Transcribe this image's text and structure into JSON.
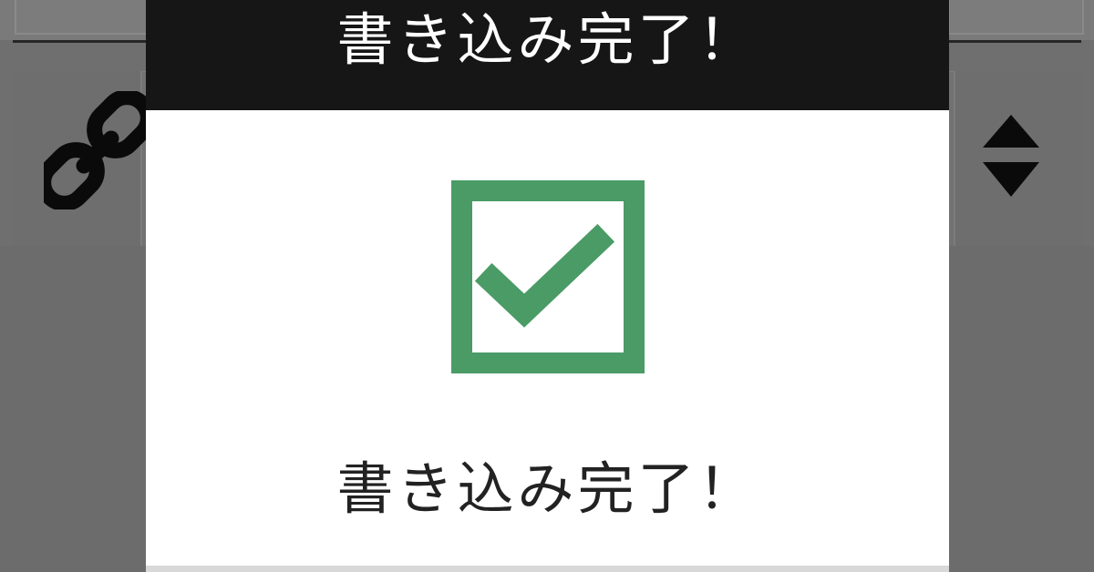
{
  "modal": {
    "title": "書き込み完了！",
    "message": "書き込み完了！",
    "icon": "checkbox-checked-icon"
  },
  "background": {
    "left_icon": "link-icon",
    "right_icon": "sort-icon"
  },
  "colors": {
    "overlay": "#6f6f6f",
    "header_bg": "#161616",
    "modal_bg": "#ffffff",
    "check_green": "#4a9b66"
  }
}
